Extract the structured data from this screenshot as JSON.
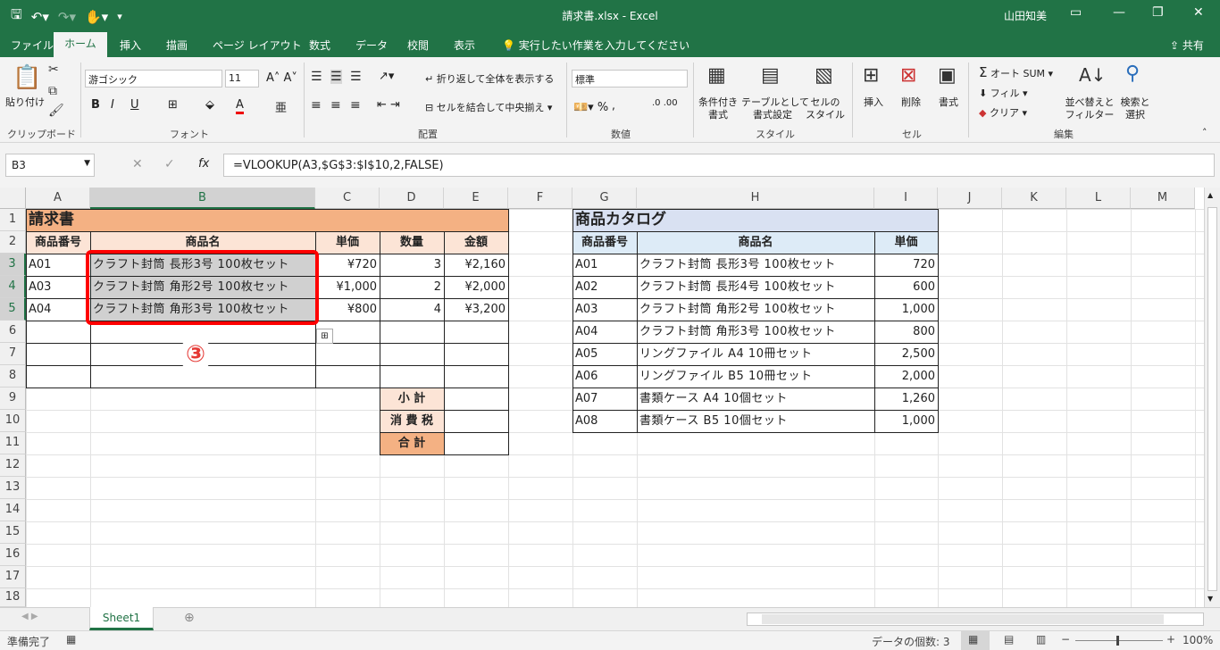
{
  "window": {
    "title": "請求書.xlsx  -  Excel",
    "user": "山田知美"
  },
  "tabs": [
    "ファイル",
    "ホーム",
    "挿入",
    "描画",
    "ページ レイアウト",
    "数式",
    "データ",
    "校閲",
    "表示"
  ],
  "active_tab": "ホーム",
  "tellme": "実行したい作業を入力してください",
  "share": "共有",
  "ribbon": {
    "clipboard": {
      "paste": "貼り付け",
      "label": "クリップボード"
    },
    "font": {
      "name": "游ゴシック",
      "size": "11",
      "label": "フォント"
    },
    "alignment": {
      "wrap": "折り返して全体を表示する",
      "merge": "セルを結合して中央揃え",
      "label": "配置"
    },
    "number": {
      "format": "標準",
      "label": "数値"
    },
    "styles": {
      "cond1": "条件付き",
      "cond2": "書式",
      "table1": "テーブルとして",
      "table2": "書式設定",
      "cell1": "セルの",
      "cell2": "スタイル",
      "label": "スタイル"
    },
    "cells": {
      "insert": "挿入",
      "delete": "削除",
      "format": "書式",
      "label": "セル"
    },
    "editing": {
      "autosum": "オート SUM",
      "fill": "フィル",
      "clear": "クリア",
      "sort1": "並べ替えと",
      "sort2": "フィルター",
      "find1": "検索と",
      "find2": "選択",
      "label": "編集"
    }
  },
  "formula_bar": {
    "name_box": "B3",
    "formula": "=VLOOKUP(A3,$G$3:$I$10,2,FALSE)"
  },
  "columns": [
    "A",
    "B",
    "C",
    "D",
    "E",
    "F",
    "G",
    "H",
    "I",
    "J",
    "K",
    "L",
    "M"
  ],
  "rows": [
    "1",
    "2",
    "3",
    "4",
    "5",
    "6",
    "7",
    "8",
    "9",
    "10",
    "11",
    "12",
    "13",
    "14",
    "15",
    "16",
    "17",
    "18"
  ],
  "invoice": {
    "title": "請求書",
    "headers": [
      "商品番号",
      "商品名",
      "単価",
      "数量",
      "金額"
    ],
    "rows": [
      [
        "A01",
        "クラフト封筒 長形3号 100枚セット",
        "¥720",
        "3",
        "¥2,160"
      ],
      [
        "A03",
        "クラフト封筒 角形2号 100枚セット",
        "¥1,000",
        "2",
        "¥2,000"
      ],
      [
        "A04",
        "クラフト封筒 角形3号 100枚セット",
        "¥800",
        "4",
        "¥3,200"
      ]
    ],
    "subtotal": "小 計",
    "tax": "消 費 税",
    "total": "合 計"
  },
  "catalog": {
    "title": "商品カタログ",
    "headers": [
      "商品番号",
      "商品名",
      "単価"
    ],
    "rows": [
      [
        "A01",
        "クラフト封筒 長形3号 100枚セット",
        "720"
      ],
      [
        "A02",
        "クラフト封筒 長形4号 100枚セット",
        "600"
      ],
      [
        "A03",
        "クラフト封筒 角形2号 100枚セット",
        "1,000"
      ],
      [
        "A04",
        "クラフト封筒 角形3号 100枚セット",
        "800"
      ],
      [
        "A05",
        "リングファイル A4 10冊セット",
        "2,500"
      ],
      [
        "A06",
        "リングファイル B5 10冊セット",
        "2,000"
      ],
      [
        "A07",
        "書類ケース A4 10個セット",
        "1,260"
      ],
      [
        "A08",
        "書類ケース B5 10個セット",
        "1,000"
      ]
    ]
  },
  "annotation": "③",
  "sheet_tab": "Sheet1",
  "status": {
    "ready": "準備完了",
    "count": "データの個数: 3",
    "zoom": "100%"
  },
  "colors": {
    "accent": "#217346",
    "invoice_title": "#f4b183",
    "invoice_header": "#fce4d6",
    "catalog_title": "#d9e1f2",
    "catalog_header": "#ddebf7",
    "highlight": "#ff0000"
  }
}
